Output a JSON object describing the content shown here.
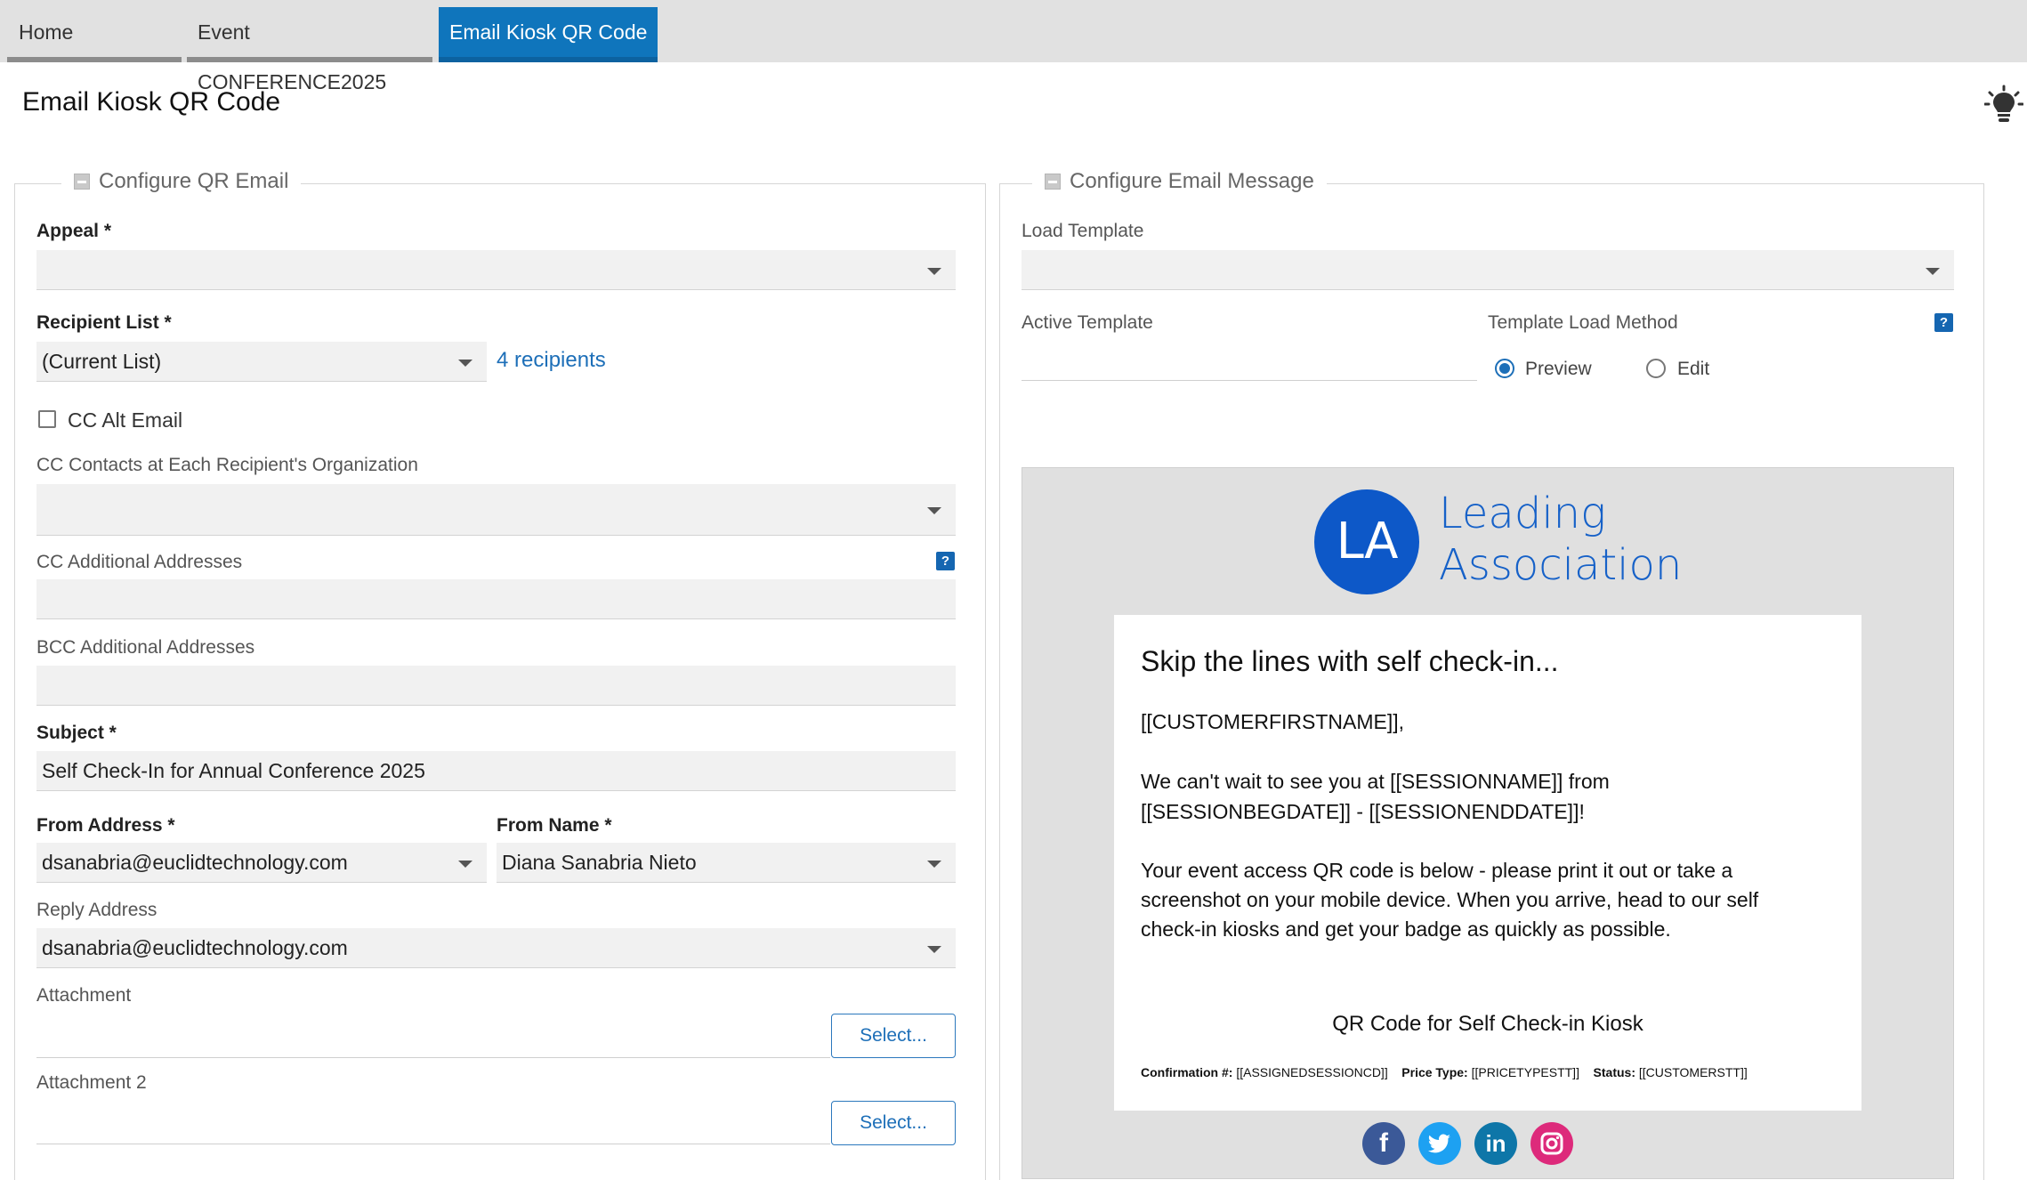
{
  "tabs": [
    {
      "label": "Home"
    },
    {
      "label": "Event CONFERENCE2025"
    },
    {
      "label": "Email Kiosk QR Code"
    }
  ],
  "page": {
    "title": "Email Kiosk QR Code",
    "help_icon": "lightbulb-icon"
  },
  "left_panel": {
    "legend": "Configure QR Email",
    "appeal": {
      "label": "Appeal *",
      "value": ""
    },
    "recipient_list": {
      "label": "Recipient List *",
      "value": "(Current List)",
      "count_link": "4 recipients"
    },
    "cc_alt_email": {
      "label": "CC Alt Email",
      "checked": false
    },
    "cc_contacts": {
      "label": "CC Contacts at Each Recipient's Organization",
      "value": ""
    },
    "cc_additional": {
      "label": "CC Additional Addresses",
      "value": ""
    },
    "bcc_additional": {
      "label": "BCC Additional Addresses",
      "value": ""
    },
    "subject": {
      "label": "Subject *",
      "value": "Self Check-In for Annual Conference 2025"
    },
    "from_address": {
      "label": "From Address *",
      "value": "dsanabria@euclidtechnology.com"
    },
    "from_name": {
      "label": "From Name *",
      "value": "Diana Sanabria Nieto"
    },
    "reply_address": {
      "label": "Reply Address",
      "value": "dsanabria@euclidtechnology.com"
    },
    "attachment": {
      "label": "Attachment",
      "button": "Select..."
    },
    "attachment2": {
      "label": "Attachment 2",
      "button": "Select..."
    }
  },
  "right_panel": {
    "legend": "Configure Email Message",
    "load_template": {
      "label": "Load Template",
      "value": ""
    },
    "active_template": {
      "label": "Active Template",
      "value": ""
    },
    "template_load_method": {
      "label": "Template Load Method",
      "options": [
        "Preview",
        "Edit"
      ],
      "selected": "Preview"
    },
    "preview": {
      "logo_initials": "LA",
      "logo_line1": "Leading",
      "logo_line2": "Association",
      "heading": "Skip the lines with self check-in...",
      "greeting": "[[CUSTOMERFIRSTNAME]],",
      "line1": "We can't wait to see you at [[SESSIONNAME]] from",
      "line2": "[[SESSIONBEGDATE]] - [[SESSIONENDDATE]]!",
      "line3": "Your event access QR code is below - please print it out or take a",
      "line4": "screenshot on your mobile device.  When you arrive, head to our self",
      "line5": "check-in kiosks and get your badge as quickly as possible.",
      "qr_label": "QR Code for Self Check-in Kiosk",
      "conf_label": "Confirmation #:",
      "conf_value": "[[ASSIGNEDSESSIONCD]]",
      "price_label": "Price Type:",
      "price_value": "[[PRICETYPESTT]]",
      "status_label": "Status:",
      "status_value": "[[CUSTOMERSTT]]",
      "social": [
        "facebook-icon",
        "twitter-icon",
        "linkedin-icon",
        "instagram-icon"
      ]
    }
  },
  "colors": {
    "accent": "#0f75bc",
    "link": "#1d6fb8",
    "logo": "#0d58c8"
  }
}
